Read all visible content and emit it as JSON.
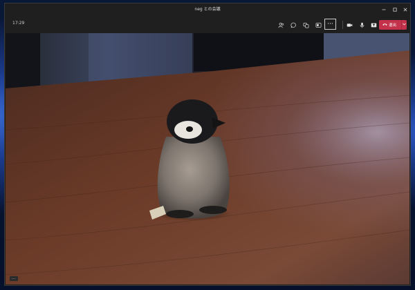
{
  "window": {
    "title": "neg との会議",
    "controls": [
      "minimize-icon",
      "maximize-icon",
      "close-icon"
    ]
  },
  "toolbar": {
    "time": "17:29",
    "buttons": [
      {
        "name": "participants-icon"
      },
      {
        "name": "chat-icon"
      },
      {
        "name": "reactions-icon"
      },
      {
        "name": "share-screen-icon"
      },
      {
        "name": "more-icon",
        "label": "···"
      },
      {
        "name": "camera-icon"
      },
      {
        "name": "microphone-icon"
      },
      {
        "name": "share-tray-icon"
      }
    ],
    "leave_label": "退出",
    "leave_color": "#c4314b"
  },
  "video": {
    "scene": "penguin-plush-on-wooden-table",
    "overflow_label": "···"
  },
  "colors": {
    "window_bg": "#1f1f1f",
    "accent_leave": "#c4314b",
    "table_wood": "#6b3a26"
  }
}
